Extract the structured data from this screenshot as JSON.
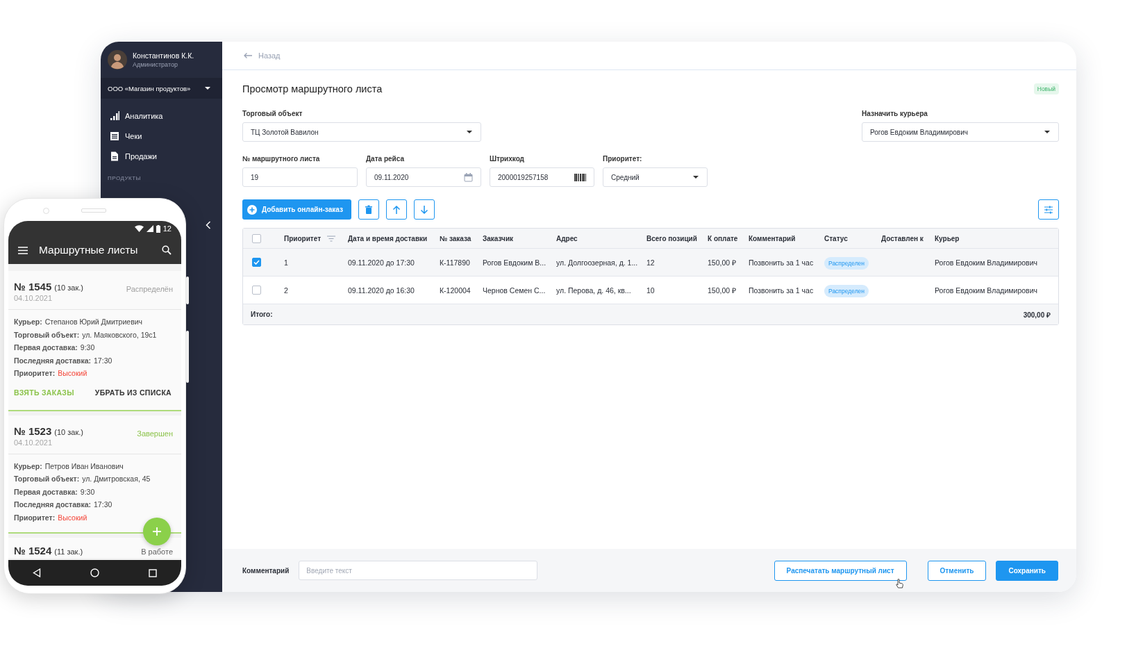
{
  "sidebar": {
    "user": {
      "name": "Константинов К.К.",
      "role": "Администратор"
    },
    "company": "ООО «Магазин продуктов»",
    "items": [
      {
        "label": "Аналитика"
      },
      {
        "label": "Чеки"
      },
      {
        "label": "Продажи"
      }
    ],
    "section": "ПРОДУКТЫ"
  },
  "back": "Назад",
  "title": "Просмотр маршрутного листа",
  "badge": "Новый",
  "fields": [
    {
      "kind": "select",
      "label": "Торговый объект",
      "value": "ТЦ Золотой Вавилон"
    },
    {
      "kind": "select",
      "label": "Назначить курьера",
      "value": "Рогов Евдоким Владимирович"
    },
    {
      "kind": "text",
      "label": "№ маршрутного листа",
      "value": "19"
    },
    {
      "kind": "date",
      "label": "Дата рейса",
      "value": "09.11.2020"
    },
    {
      "kind": "barcode",
      "label": "Штрихкод",
      "value": "2000019257158"
    },
    {
      "kind": "select",
      "label": "Приоритет:",
      "value": "Средний"
    }
  ],
  "add_button": "Добавить онлайн-заказ",
  "table": {
    "all_selected": false,
    "columns": [
      "Приоритет",
      "Дата и время доставки",
      "№ заказа",
      "Заказчик",
      "Адрес",
      "Всего позиций",
      "К оплате",
      "Комментарий",
      "Статус",
      "Доставлен к",
      "Курьер"
    ],
    "rows": [
      {
        "selected": true,
        "priority": "1",
        "delivery": "09.11.2020 до 17:30",
        "order": "К-117890",
        "customer": "Рогов Евдоким В...",
        "address": "ул. Долгоозерная, д. 1...",
        "positions": "12",
        "amount": "150,00 ₽",
        "comment": "Позвонить за 1 час",
        "status": "Распределен",
        "courier": "Рогов Евдоким Владимирович"
      },
      {
        "selected": false,
        "priority": "2",
        "delivery": "09.11.2020 до 16:30",
        "order": "К-120004",
        "customer": "Чернов Семен С...",
        "address": "ул. Перова, д. 46, кв...",
        "positions": "10",
        "amount": "150,00 ₽",
        "comment": "Позвонить за 1 час",
        "status": "Распределен",
        "courier": "Рогов Евдоким Владимирович"
      }
    ],
    "total": {
      "label": "Итого:",
      "value": "300,00 ₽"
    }
  },
  "footer": {
    "comment_label": "Комментарий",
    "comment_placeholder": "Введите текст",
    "buttons": [
      {
        "kind": "outline",
        "label": "Распечатать маршрутный лист"
      },
      {
        "kind": "outline",
        "label": "Отменить"
      },
      {
        "kind": "primary",
        "label": "Сохранить"
      }
    ]
  },
  "phone": {
    "time": "12",
    "title": "Маршрутные листы",
    "cards": [
      {
        "number": "№ 1545",
        "count": "(10 зак.)",
        "date": "04.10.2021",
        "status": "Распределён",
        "color": "#9e9e9e",
        "details": [
          {
            "kind": "plain",
            "label": "Курьер:",
            "value": "Степанов Юрий Дмитриевич"
          },
          {
            "kind": "plain",
            "label": "Торговый объект:",
            "value": "ул. Маяковского, 19с1"
          },
          {
            "kind": "plain",
            "label": "Первая доставка:",
            "value": "9:30"
          },
          {
            "kind": "plain",
            "label": "Последняя доставка:",
            "value": "17:30"
          },
          {
            "kind": "alert",
            "label": "Приоритет:",
            "value": "Высокий"
          }
        ],
        "actions": [
          {
            "kind": "accent",
            "label": "ВЗЯТЬ ЗАКАЗЫ"
          },
          {
            "kind": "plain",
            "label": "УБРАТЬ ИЗ СПИСКА"
          }
        ]
      },
      {
        "number": "№ 1523",
        "count": "(10 зак.)",
        "date": "04.10.2021",
        "status": "Завершен",
        "color": "#8bc34a",
        "details": [
          {
            "kind": "plain",
            "label": "Курьер:",
            "value": "Петров Иван Иванович"
          },
          {
            "kind": "plain",
            "label": "Торговый объект:",
            "value": "ул. Дмитровская, 45"
          },
          {
            "kind": "plain",
            "label": "Первая доставка:",
            "value": "9:30"
          },
          {
            "kind": "plain",
            "label": "Последняя доставка:",
            "value": "17:30"
          },
          {
            "kind": "alert",
            "label": "Приоритет:",
            "value": "Высокий"
          }
        ]
      },
      {
        "number": "№ 1524",
        "count": "(11 зак.)",
        "status": "В работе",
        "color": "#616161"
      }
    ]
  }
}
